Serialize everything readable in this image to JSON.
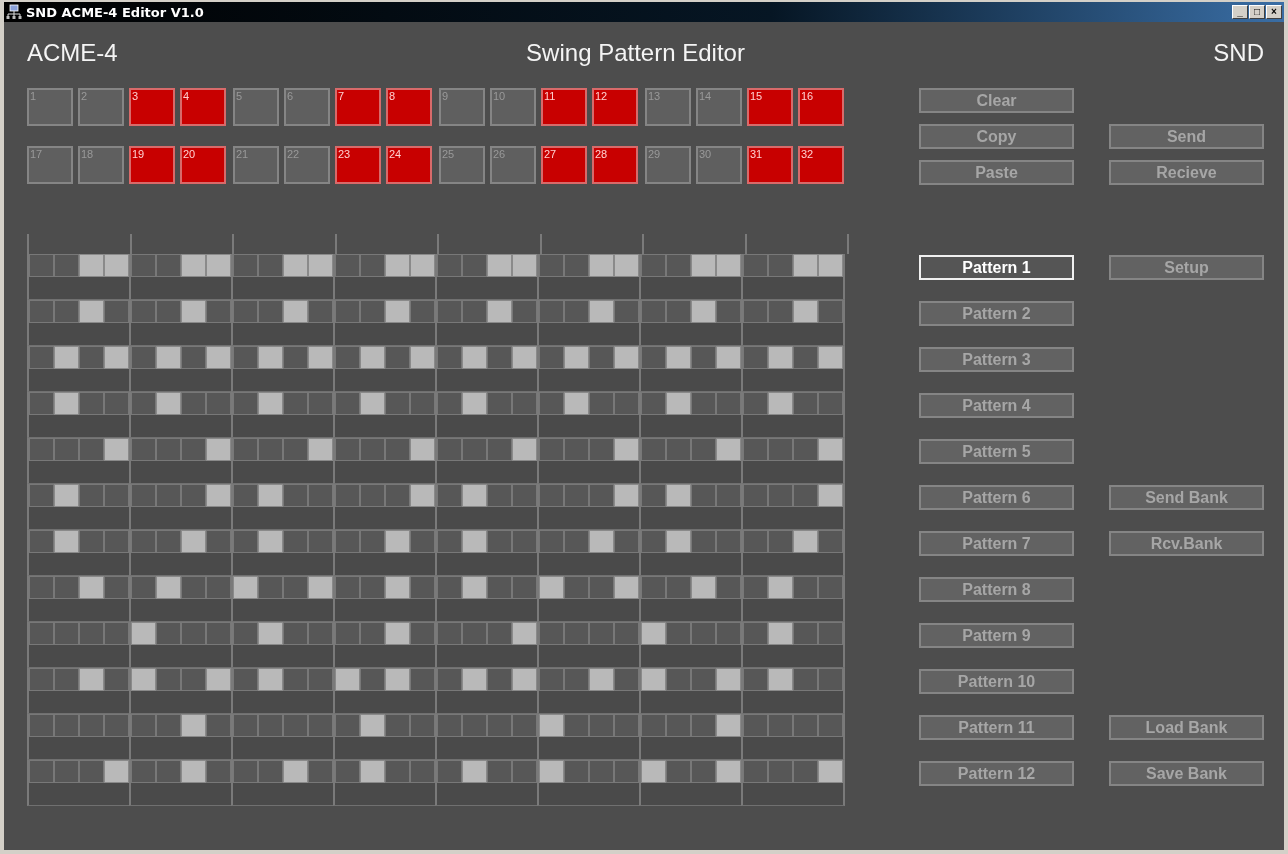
{
  "window": {
    "title": "SND ACME-4 Editor V1.0",
    "controls": [
      "_",
      "□",
      "×"
    ]
  },
  "header": {
    "left": "ACME-4",
    "title": "Swing Pattern Editor",
    "right": "SND"
  },
  "steps": [
    {
      "label": "1",
      "on": false
    },
    {
      "label": "2",
      "on": false
    },
    {
      "label": "3",
      "on": true
    },
    {
      "label": "4",
      "on": true
    },
    {
      "label": "5",
      "on": false
    },
    {
      "label": "6",
      "on": false
    },
    {
      "label": "7",
      "on": true
    },
    {
      "label": "8",
      "on": true
    },
    {
      "label": "9",
      "on": false
    },
    {
      "label": "10",
      "on": false
    },
    {
      "label": "11",
      "on": true
    },
    {
      "label": "12",
      "on": true
    },
    {
      "label": "13",
      "on": false
    },
    {
      "label": "14",
      "on": false
    },
    {
      "label": "15",
      "on": true
    },
    {
      "label": "16",
      "on": true
    },
    {
      "label": "17",
      "on": false
    },
    {
      "label": "18",
      "on": false
    },
    {
      "label": "19",
      "on": true
    },
    {
      "label": "20",
      "on": true
    },
    {
      "label": "21",
      "on": false
    },
    {
      "label": "22",
      "on": false
    },
    {
      "label": "23",
      "on": true
    },
    {
      "label": "24",
      "on": true
    },
    {
      "label": "25",
      "on": false
    },
    {
      "label": "26",
      "on": false
    },
    {
      "label": "27",
      "on": true
    },
    {
      "label": "28",
      "on": true
    },
    {
      "label": "29",
      "on": false
    },
    {
      "label": "30",
      "on": false
    },
    {
      "label": "31",
      "on": true
    },
    {
      "label": "32",
      "on": true
    }
  ],
  "edit_buttons": [
    {
      "left": "Clear"
    },
    {
      "left": "Copy",
      "right": "Send"
    },
    {
      "left": "Paste",
      "right": "Recieve"
    }
  ],
  "patterns": [
    {
      "label": "Pattern 1",
      "selected": true,
      "side_button": "Setup",
      "cells": [
        false,
        false,
        true,
        true,
        false,
        false,
        true,
        true,
        false,
        false,
        true,
        true,
        false,
        false,
        true,
        true,
        false,
        false,
        true,
        true,
        false,
        false,
        true,
        true,
        false,
        false,
        true,
        true,
        false,
        false,
        true,
        true
      ]
    },
    {
      "label": "Pattern 2",
      "selected": false,
      "cells": [
        false,
        false,
        true,
        false,
        false,
        false,
        true,
        false,
        false,
        false,
        true,
        false,
        false,
        false,
        true,
        false,
        false,
        false,
        true,
        false,
        false,
        false,
        true,
        false,
        false,
        false,
        true,
        false,
        false,
        false,
        true,
        false
      ]
    },
    {
      "label": "Pattern 3",
      "selected": false,
      "cells": [
        false,
        true,
        false,
        true,
        false,
        true,
        false,
        true,
        false,
        true,
        false,
        true,
        false,
        true,
        false,
        true,
        false,
        true,
        false,
        true,
        false,
        true,
        false,
        true,
        false,
        true,
        false,
        true,
        false,
        true,
        false,
        true
      ]
    },
    {
      "label": "Pattern 4",
      "selected": false,
      "cells": [
        false,
        true,
        false,
        false,
        false,
        true,
        false,
        false,
        false,
        true,
        false,
        false,
        false,
        true,
        false,
        false,
        false,
        true,
        false,
        false,
        false,
        true,
        false,
        false,
        false,
        true,
        false,
        false,
        false,
        true,
        false,
        false
      ]
    },
    {
      "label": "Pattern 5",
      "selected": false,
      "cells": [
        false,
        false,
        false,
        true,
        false,
        false,
        false,
        true,
        false,
        false,
        false,
        true,
        false,
        false,
        false,
        true,
        false,
        false,
        false,
        true,
        false,
        false,
        false,
        true,
        false,
        false,
        false,
        true,
        false,
        false,
        false,
        true
      ]
    },
    {
      "label": "Pattern 6",
      "selected": false,
      "side_button": "Send Bank",
      "cells": [
        false,
        true,
        false,
        false,
        false,
        false,
        false,
        true,
        false,
        true,
        false,
        false,
        false,
        false,
        false,
        true,
        false,
        true,
        false,
        false,
        false,
        false,
        false,
        true,
        false,
        true,
        false,
        false,
        false,
        false,
        false,
        true
      ]
    },
    {
      "label": "Pattern 7",
      "selected": false,
      "side_button": "Rcv.Bank",
      "cells": [
        false,
        true,
        false,
        false,
        false,
        false,
        true,
        false,
        false,
        true,
        false,
        false,
        false,
        false,
        true,
        false,
        false,
        true,
        false,
        false,
        false,
        false,
        true,
        false,
        false,
        true,
        false,
        false,
        false,
        false,
        true,
        false
      ]
    },
    {
      "label": "Pattern 8",
      "selected": false,
      "cells": [
        false,
        false,
        true,
        false,
        false,
        true,
        false,
        false,
        true,
        false,
        false,
        true,
        false,
        false,
        true,
        false,
        false,
        true,
        false,
        false,
        true,
        false,
        false,
        true,
        false,
        false,
        true,
        false,
        false,
        true,
        false,
        false
      ]
    },
    {
      "label": "Pattern 9",
      "selected": false,
      "cells": [
        false,
        false,
        false,
        false,
        true,
        false,
        false,
        false,
        false,
        true,
        false,
        false,
        false,
        false,
        true,
        false,
        false,
        false,
        false,
        true,
        false,
        false,
        false,
        false,
        true,
        false,
        false,
        false,
        false,
        true,
        false,
        false
      ]
    },
    {
      "label": "Pattern 10",
      "selected": false,
      "cells": [
        false,
        false,
        true,
        false,
        true,
        false,
        false,
        true,
        false,
        true,
        false,
        false,
        true,
        false,
        true,
        false,
        false,
        true,
        false,
        true,
        false,
        false,
        true,
        false,
        true,
        false,
        false,
        true,
        false,
        true,
        false,
        false
      ]
    },
    {
      "label": "Pattern 11",
      "selected": false,
      "side_button": "Load Bank",
      "cells": [
        false,
        false,
        false,
        false,
        false,
        false,
        true,
        false,
        false,
        false,
        false,
        false,
        false,
        true,
        false,
        false,
        false,
        false,
        false,
        false,
        true,
        false,
        false,
        false,
        false,
        false,
        false,
        true,
        false,
        false,
        false,
        false
      ]
    },
    {
      "label": "Pattern 12",
      "selected": false,
      "side_button": "Save Bank",
      "cells": [
        false,
        false,
        false,
        true,
        false,
        false,
        true,
        false,
        false,
        false,
        true,
        false,
        false,
        true,
        false,
        false,
        false,
        true,
        false,
        false,
        true,
        false,
        false,
        false,
        true,
        false,
        false,
        true,
        false,
        false,
        false,
        true
      ]
    }
  ]
}
